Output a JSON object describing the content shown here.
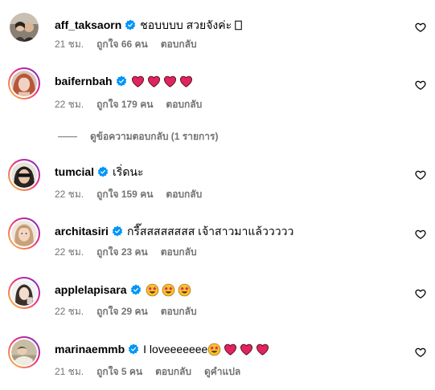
{
  "comments": [
    {
      "username": "aff_taksaorn",
      "text": "ชอบบบบ สวยจังค่ะ",
      "emojis": [
        "box"
      ],
      "time": "21 ชม.",
      "likes": "ถูกใจ 66 คน",
      "reply": "ตอบกลับ",
      "has_ring": false
    },
    {
      "username": "baifernbah",
      "text": "",
      "emojis": [
        "heart",
        "heart",
        "heart",
        "heart"
      ],
      "time": "22 ชม.",
      "likes": "ถูกใจ 179 คน",
      "reply": "ตอบกลับ",
      "has_ring": true
    },
    {
      "username": "tumcial",
      "text": "เริ่ดนะ",
      "emojis": [],
      "time": "22 ชม.",
      "likes": "ถูกใจ 159 คน",
      "reply": "ตอบกลับ",
      "has_ring": true
    },
    {
      "username": "architasiri",
      "text": "กรี๊สสสสสสสส เจ้าสาวมาแล้ววววว",
      "emojis": [],
      "time": "22 ชม.",
      "likes": "ถูกใจ 23 คน",
      "reply": "ตอบกลับ",
      "has_ring": true
    },
    {
      "username": "applelapisara",
      "text": "",
      "emojis": [
        "star-eyes",
        "star-eyes",
        "star-eyes"
      ],
      "time": "22 ชม.",
      "likes": "ถูกใจ 29 คน",
      "reply": "ตอบกลับ",
      "has_ring": true
    },
    {
      "username": "marinaemmb",
      "text": "I loveeeeeee",
      "emojis": [
        "star-eyes",
        "heart",
        "heart",
        "heart"
      ],
      "time": "21 ชม.",
      "likes": "ถูกใจ 5 คน",
      "reply": "ตอบกลับ",
      "translate": "ดูคำแปล",
      "has_ring": true
    }
  ],
  "view_replies": "ดูข้อความตอบกลับ (1 รายการ)",
  "colors": {
    "verified": "#0095f6",
    "heart": "#e0245e",
    "meta_text": "#737373",
    "story_ring_start": "#f9ce34",
    "story_ring_end": "#6228d7"
  }
}
